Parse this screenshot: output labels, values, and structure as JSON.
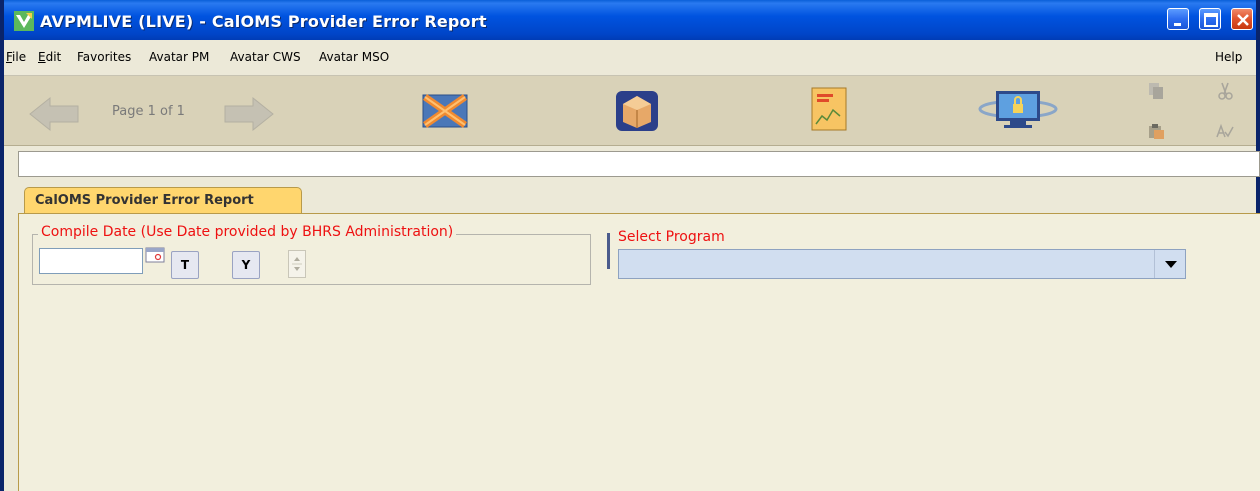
{
  "window": {
    "title": "AVPMLIVE (LIVE) - CalOMS Provider Error Report",
    "colors": {
      "titlebar": "#0053e0",
      "tab": "#ffd66e",
      "label": "#ee1111",
      "select": "#d1def0"
    }
  },
  "menu": {
    "items": [
      "File",
      "Edit",
      "Favorites",
      "Avatar PM",
      "Avatar CWS",
      "Avatar MSO"
    ],
    "help": "Help"
  },
  "toolbar": {
    "page_label": "Page 1 of 1",
    "icons": [
      "back-arrow-icon",
      "forward-arrow-icon",
      "close-form-icon",
      "submit-box-icon",
      "report-icon",
      "lock-monitor-icon",
      "copy-icon",
      "paste-icon",
      "cut-icon",
      "spell-check-icon"
    ]
  },
  "status": {
    "text": ""
  },
  "tabs": [
    {
      "label": "CalOMS Provider Error Report",
      "active": true
    }
  ],
  "form": {
    "compile_date": {
      "label": "Compile Date (Use Date provided by BHRS Administration)",
      "value": "",
      "today_button": "T",
      "yesterday_button": "Y"
    },
    "program": {
      "label": "Select Program",
      "value": ""
    }
  }
}
